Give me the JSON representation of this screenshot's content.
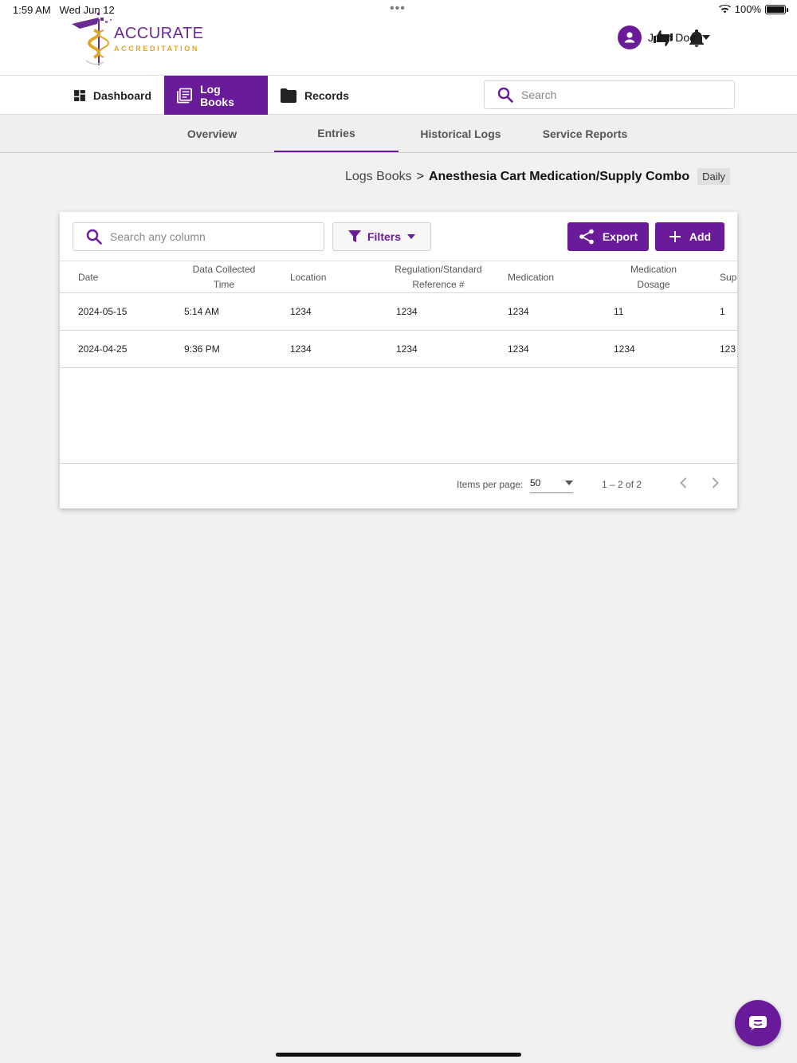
{
  "status_bar": {
    "time": "1:59 AM",
    "date": "Wed Jun 12",
    "battery": "100%"
  },
  "header": {
    "logo_line1": "ACCURATE",
    "logo_line2": "ACCREDITATION",
    "user_name": "John Doe"
  },
  "nav": {
    "items": [
      {
        "label": "Dashboard",
        "icon": "dashboard-icon"
      },
      {
        "label": "Log Books",
        "icon": "book-icon",
        "active": true
      },
      {
        "label": "Records",
        "icon": "folder-icon"
      }
    ],
    "search_placeholder": "Search"
  },
  "subtabs": [
    {
      "label": "Overview"
    },
    {
      "label": "Entries",
      "active": true
    },
    {
      "label": "Historical Logs"
    },
    {
      "label": "Service Reports"
    }
  ],
  "breadcrumb": {
    "root": "Logs Books",
    "separator": ">",
    "current": "Anesthesia Cart Medication/Supply Combo",
    "badge": "Daily"
  },
  "toolbar": {
    "search_placeholder": "Search any column",
    "filters_label": "Filters",
    "export_label": "Export",
    "add_label": "Add"
  },
  "table": {
    "headers": [
      "Date",
      "Data Collected Time",
      "Location",
      "Regulation/Standard Reference #",
      "Medication",
      "Medication Dosage",
      "Supp"
    ],
    "rows": [
      [
        "2024-05-15",
        "5:14 AM",
        "1234",
        "1234",
        "1234",
        "11",
        "1"
      ],
      [
        "2024-04-25",
        "9:36 PM",
        "1234",
        "1234",
        "1234",
        "1234",
        "123"
      ]
    ]
  },
  "paginator": {
    "label": "Items per page:",
    "page_size": "50",
    "range": "1 – 2 of 2"
  },
  "colors": {
    "accent": "#6a1b9a",
    "logo_gold": "#e0a526"
  }
}
